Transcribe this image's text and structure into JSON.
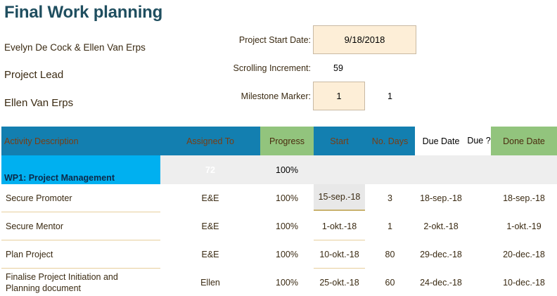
{
  "title": "Final Work planning",
  "authors": "Evelyn De Cock & Ellen Van Erps",
  "role_label": "Project Lead",
  "lead_name": "Ellen Van Erps",
  "settings": {
    "start_date_label": "Project Start Date:",
    "start_date_value": "9/18/2018",
    "scroll_label": "Scrolling Increment:",
    "scroll_value": "59",
    "milestone_label": "Milestone Marker:",
    "milestone_value": "1",
    "milestone_extra": "1"
  },
  "headers": {
    "activity": "Activity Description",
    "assigned": "Assigned To",
    "progress": "Progress",
    "start": "Start",
    "days": "No. Days",
    "due": "Due Date",
    "due_q": "Due ?",
    "done": "Done Date"
  },
  "wp1": {
    "label": "WP1: Project Management",
    "assigned": "72",
    "progress": "100%"
  },
  "rows": [
    {
      "desc": "Secure Promoter",
      "assigned": "E&E",
      "progress": "100%",
      "start": "15-sep.-18",
      "days": "3",
      "due": "18-sep.-18",
      "done": "18-sep.-18"
    },
    {
      "desc": "Secure Mentor",
      "assigned": "E&E",
      "progress": "100%",
      "start": "1-okt.-18",
      "days": "1",
      "due": "2-okt.-18",
      "done": "1-okt.-19"
    },
    {
      "desc": "Plan Project",
      "assigned": "E&E",
      "progress": "100%",
      "start": "10-okt.-18",
      "days": "80",
      "due": "29-dec.-18",
      "done": "20-dec.-18"
    },
    {
      "desc": "Finalise Project Initiation and Planning document",
      "assigned": "Ellen",
      "progress": "100%",
      "start": "25-okt.-18",
      "days": "60",
      "due": "24-dec.-18",
      "done": "10-dec.-18"
    }
  ],
  "colors": {
    "header_blue": "#137fb0",
    "header_green": "#92c47d",
    "wp_cyan": "#00b0f0",
    "input_fill": "#fdeed7"
  }
}
